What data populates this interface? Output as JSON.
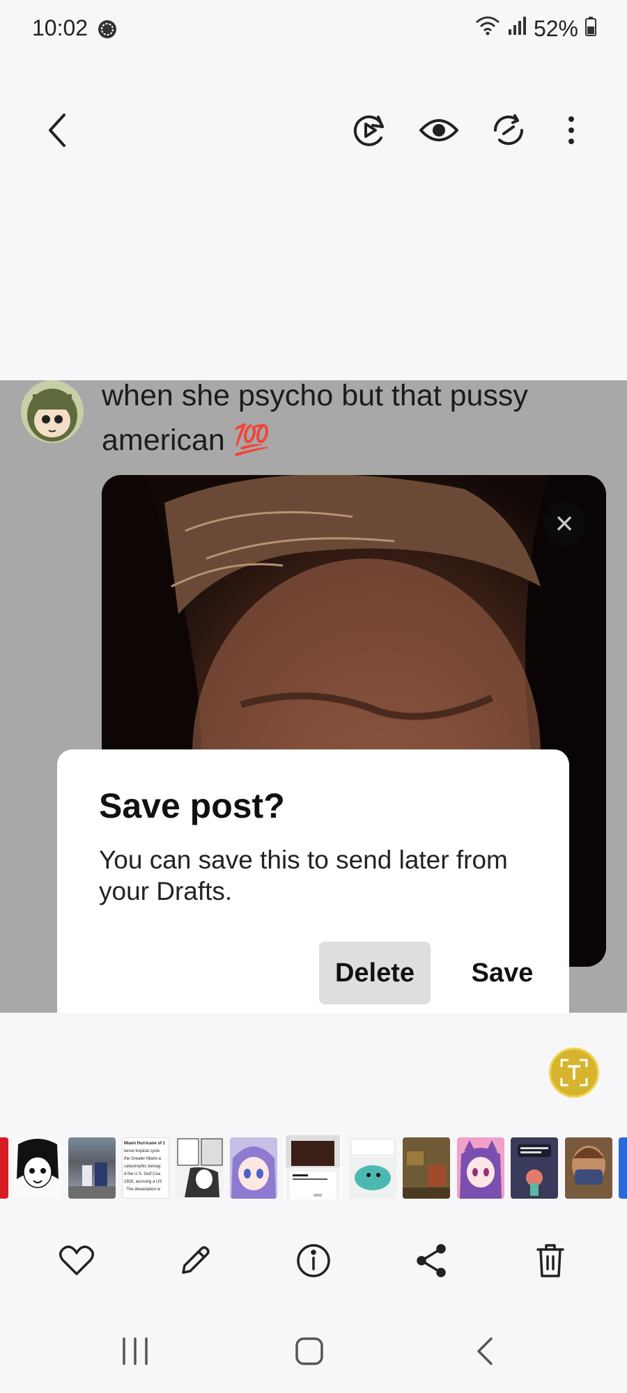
{
  "status_bar": {
    "time": "10:02",
    "battery": "52%",
    "icons": [
      "messenger-icon",
      "wifi-icon",
      "signal-icon",
      "battery-icon"
    ]
  },
  "top_bar": {
    "icons": [
      "back-icon",
      "play-remaster-icon",
      "eye-icon",
      "rotate-icon",
      "more-icon"
    ]
  },
  "image": {
    "tweet_text": "when she psycho but that pussy american 💯",
    "media_close": "×",
    "dialog": {
      "title": "Save post?",
      "body": "You can save this to send later from your Drafts.",
      "delete_label": "Delete",
      "save_label": "Save"
    }
  },
  "text_recognition": {
    "icon": "text-scan-icon",
    "accent": "#d6b42e"
  },
  "thumbnails": {
    "items": [
      {
        "name": "thumb-red-partial"
      },
      {
        "name": "thumb-manga-girl"
      },
      {
        "name": "thumb-street-photo"
      },
      {
        "name": "thumb-article-text",
        "lines": [
          "Miami Hurricane of 1",
          "tense tropical cyclo",
          "the Greater Miami a",
          "catastrophic damag",
          "d the U.S. Gulf Coa",
          "1926, accruing a US",
          ". The devastation w"
        ]
      },
      {
        "name": "thumb-manga-page"
      },
      {
        "name": "thumb-anime-girl-purple"
      },
      {
        "name": "thumb-current-save-post"
      },
      {
        "name": "thumb-teal-creature"
      },
      {
        "name": "thumb-room-photo"
      },
      {
        "name": "thumb-catgirl-pink"
      },
      {
        "name": "thumb-dark-message"
      },
      {
        "name": "thumb-masked-man"
      },
      {
        "name": "thumb-blue-partial"
      }
    ]
  },
  "bottom_toolbar": {
    "icons": [
      "heart-icon",
      "edit-pencil-icon",
      "info-icon",
      "share-icon",
      "trash-icon"
    ]
  },
  "nav_bar": {
    "icons": [
      "recents-icon",
      "home-icon",
      "back-nav-icon"
    ]
  }
}
